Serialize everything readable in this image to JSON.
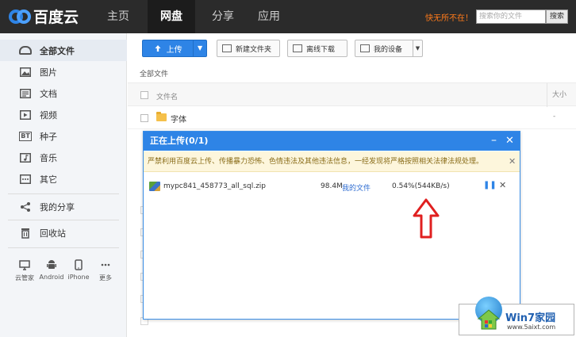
{
  "app": {
    "logo_text": "百度云"
  },
  "topnav": {
    "items": [
      {
        "label": "主页",
        "active": false
      },
      {
        "label": "网盘",
        "active": true
      },
      {
        "label": "分享",
        "active": false
      },
      {
        "label": "应用",
        "active": false
      }
    ],
    "promo_link": "快无所不在！",
    "search_placeholder": "搜索你的文件",
    "search_button": "搜索"
  },
  "sidebar": {
    "items": [
      {
        "label": "全部文件",
        "icon": "cloud-icon",
        "active": true
      },
      {
        "label": "图片",
        "icon": "image-icon"
      },
      {
        "label": "文档",
        "icon": "document-icon"
      },
      {
        "label": "视频",
        "icon": "video-icon"
      },
      {
        "label": "种子",
        "icon": "bt-icon",
        "icon_text": "BT"
      },
      {
        "label": "音乐",
        "icon": "music-icon"
      },
      {
        "label": "其它",
        "icon": "more-icon"
      }
    ],
    "share": {
      "label": "我的分享",
      "icon": "share-icon"
    },
    "recycle": {
      "label": "回收站",
      "icon": "trash-icon"
    },
    "devices": [
      {
        "label": "云管家",
        "icon": "monitor-icon"
      },
      {
        "label": "Android",
        "icon": "android-icon"
      },
      {
        "label": "iPhone",
        "icon": "iphone-icon"
      },
      {
        "label": "更多",
        "icon": "more-dots-icon"
      }
    ]
  },
  "toolbar": {
    "upload_label": "上传",
    "new_folder_label": "新建文件夹",
    "offline_download_label": "离线下载",
    "my_devices_label": "我的设备"
  },
  "breadcrumb": "全部文件",
  "file_list": {
    "columns": {
      "name": "文件名",
      "size": "大小"
    },
    "rows": [
      {
        "name": "字体",
        "size": "-",
        "type": "folder"
      }
    ]
  },
  "upload_dialog": {
    "title": "正在上传(0/1)",
    "warning": "严禁利用百度云上传、传播暴力恐怖、色情违法及其他违法信息，一经发现将严格按照相关法律法规处理。",
    "items": [
      {
        "file_name": "mypc841_458773_all_sql.zip",
        "size": "98.4M",
        "destination": "我的文件",
        "progress_text": "0.54%(544KB/s)",
        "progress_percent": 0.54
      }
    ]
  },
  "watermark": {
    "title": "Win7家园",
    "url": "www.5aixt.com"
  },
  "colors": {
    "accent": "#2e84e6",
    "topbar": "#2b2b2b",
    "promo": "#ff7a1a",
    "arrow": "#e02020"
  }
}
